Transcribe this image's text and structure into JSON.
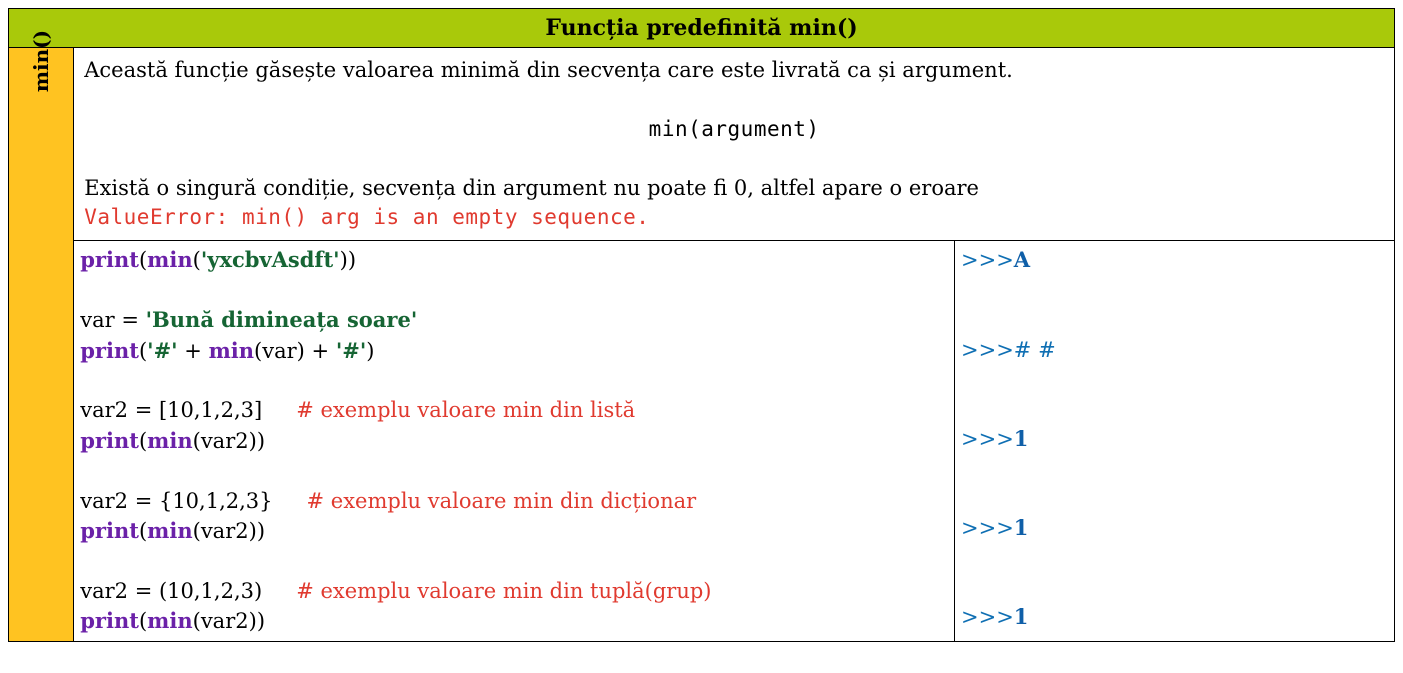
{
  "header": "Funcția predefinită min()",
  "sidebar": "min()",
  "desc": {
    "p1": "Această funcție găsește valoarea minimă din secvența care este livrată ca și argument.",
    "sig": "min(argument)",
    "p2": "Există o singură condiție, secvența din argument nu poate fi 0, altfel apare o eroare",
    "err": "ValueError: min() arg is an empty sequence."
  },
  "code": {
    "l1": {
      "print": "print",
      "min": "min",
      "lp1": "(",
      "lp2": "(",
      "s": "'yxcbvAsdft'",
      "rp1": ")",
      "rp2": ")"
    },
    "l2": {
      "txt": "var = ",
      "s": "'Bună dimineața soare'"
    },
    "l3": {
      "print": "print",
      "lp": "(",
      "s1": "'#'",
      "plus1": " + ",
      "min": "min",
      "lp2": "(",
      "v": "var",
      "rp2": ")",
      "plus2": " + ",
      "s2": "'#'",
      "rp": ")"
    },
    "l4": {
      "txt": "var2 = [10,1,2,3]",
      "cmt": "# exemplu valoare min din listă"
    },
    "l5": {
      "print": "print",
      "lp": "(",
      "min": "min",
      "lp2": "(",
      "v": "var2",
      "rp2": ")",
      "rp": ")"
    },
    "l6": {
      "txt": "var2 = {10,1,2,3}",
      "cmt": "# exemplu valoare min din dicționar"
    },
    "l7": {
      "print": "print",
      "lp": "(",
      "min": "min",
      "lp2": "(",
      "v": "var2",
      "rp2": ")",
      "rp": ")"
    },
    "l8": {
      "txt": "var2 = (10,1,2,3)",
      "cmt": "# exemplu valoare min din tuplă(grup)"
    },
    "l9": {
      "print": "print",
      "lp": "(",
      "min": "min",
      "lp2": "(",
      "v": "var2",
      "rp2": ")",
      "rp": ")"
    }
  },
  "out": {
    "prompt": ">>>",
    "o1": "A",
    "o2": "# #",
    "o3": "1",
    "o4": "1",
    "o5": "1"
  }
}
